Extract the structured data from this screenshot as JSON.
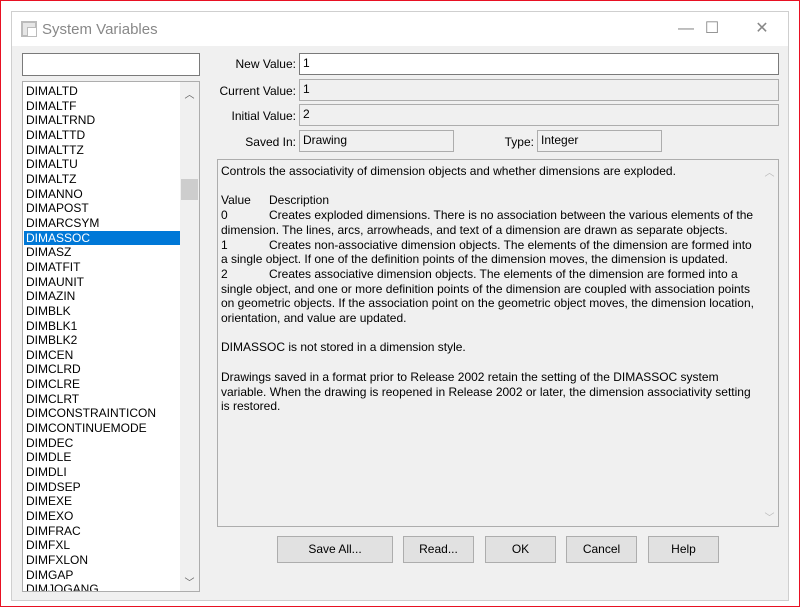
{
  "window": {
    "title": "System Variables",
    "minimize": "—",
    "maximize": "☐",
    "close": "✕"
  },
  "search": {
    "value": "",
    "placeholder": ""
  },
  "variables": [
    "DIMALTD",
    "DIMALTF",
    "DIMALTRND",
    "DIMALTTD",
    "DIMALTTZ",
    "DIMALTU",
    "DIMALTZ",
    "DIMANNO",
    "DIMAPOST",
    "DIMARCSYM",
    "DIMASSOC",
    "DIMASZ",
    "DIMATFIT",
    "DIMAUNIT",
    "DIMAZIN",
    "DIMBLK",
    "DIMBLK1",
    "DIMBLK2",
    "DIMCEN",
    "DIMCLRD",
    "DIMCLRE",
    "DIMCLRT",
    "DIMCONSTRAINTICON",
    "DIMCONTINUEMODE",
    "DIMDEC",
    "DIMDLE",
    "DIMDLI",
    "DIMDSEP",
    "DIMEXE",
    "DIMEXO",
    "DIMFRAC",
    "DIMFXL",
    "DIMFXLON",
    "DIMGAP",
    "DIMJOGANG"
  ],
  "selected_variable": "DIMASSOC",
  "fields": {
    "new_value_label": "New Value:",
    "new_value": "1",
    "current_value_label": "Current Value:",
    "current_value": "1",
    "initial_value_label": "Initial Value:",
    "initial_value": "2",
    "saved_in_label": "Saved In:",
    "saved_in": "Drawing",
    "type_label": "Type:",
    "type": "Integer"
  },
  "description": {
    "intro": "Controls the associativity of dimension objects and whether dimensions are exploded.",
    "header_value": "Value",
    "header_desc": "Description",
    "rows": [
      {
        "value": "0",
        "text": "Creates exploded dimensions. There is no association between the various elements of the dimension. The lines, arcs, arrowheads, and text of a dimension are drawn as separate objects."
      },
      {
        "value": "1",
        "text": "Creates non-associative dimension objects. The elements of the dimension are formed into a single object. If one of the definition points of the dimension moves, the dimension is updated."
      },
      {
        "value": "2",
        "text": "Creates associative dimension objects. The elements of the dimension are formed into a single object, and one or more definition points of the dimension are coupled with association points on geometric objects. If the association point on the geometric object moves, the dimension location, orientation, and value are updated."
      }
    ],
    "note1": "DIMASSOC is not stored in a dimension style.",
    "note2": "Drawings saved in a format prior to Release 2002 retain the setting of the DIMASSOC system variable. When the drawing is reopened in Release 2002 or later, the dimension associativity setting is restored."
  },
  "buttons": {
    "save_all": "Save All...",
    "read": "Read...",
    "ok": "OK",
    "cancel": "Cancel",
    "help": "Help"
  },
  "colors": {
    "selection": "#0078d7",
    "frame": "#e81123"
  }
}
